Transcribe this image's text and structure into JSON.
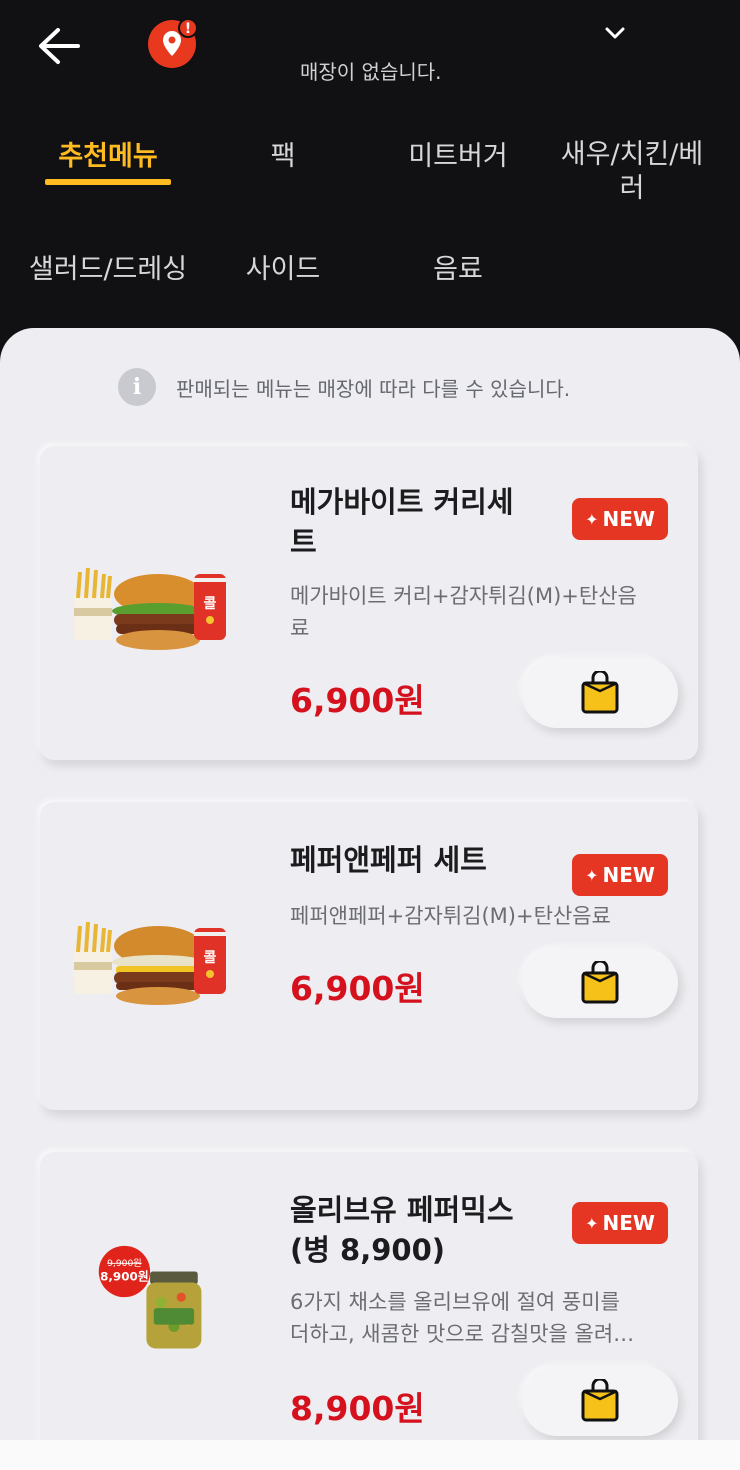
{
  "header": {
    "store_message": "매장이 없습니다.",
    "icons": [
      "back-arrow-icon",
      "location-pin-icon",
      "alert-badge-icon",
      "chevron-down-icon"
    ],
    "alert_mark": "!"
  },
  "tabs": [
    {
      "label": "추천메뉴",
      "active": true
    },
    {
      "label": "팩",
      "active": false
    },
    {
      "label": "미트버거",
      "active": false
    },
    {
      "label": "새우/치킨/베\n러",
      "active": false
    },
    {
      "label": "샐러드/드레싱",
      "active": false
    },
    {
      "label": "사이드",
      "active": false
    },
    {
      "label": "음료",
      "active": false
    }
  ],
  "notice": {
    "icon_glyph": "i",
    "text": "판매되는 메뉴는 매장에 따라 다를 수 있습니다."
  },
  "products": [
    {
      "title": "메가바이트 커리세\n트",
      "badge": "NEW",
      "description": "메가바이트 커리+감자튀김(M)+탄산음\n료",
      "price": "6,900원"
    },
    {
      "title": "페퍼앤페퍼 세트",
      "badge": "NEW",
      "description": "페퍼앤페퍼+감자튀김(M)+탄산음료",
      "price": "6,900원"
    },
    {
      "title": "올리브유 페퍼믹스\n(병 8,900)",
      "badge": "NEW",
      "description": "6가지 채소를 올리브유에 절여 풍미를\n더하고, 새콤한 맛으로 감칠맛을 올려…",
      "price": "8,900원",
      "sticker_old_price": "9,900원",
      "sticker_new_price": "8,900원"
    }
  ],
  "colors": {
    "header_bg": "#111113",
    "active_tab": "#ffbb1f",
    "price": "#d4111c",
    "badge": "#e53523",
    "content_bg": "#eeeef2"
  }
}
